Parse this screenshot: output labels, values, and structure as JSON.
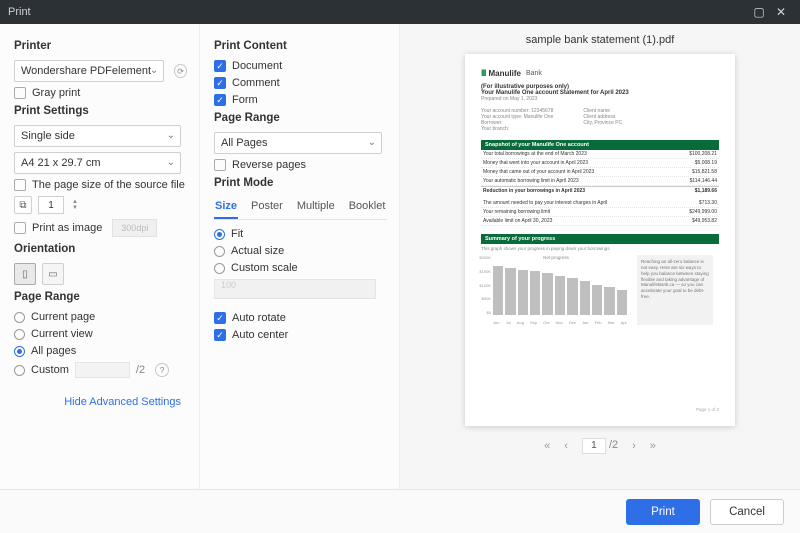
{
  "titlebar": {
    "title": "Print"
  },
  "printer": {
    "heading": "Printer",
    "selected": "Wondershare PDFelement",
    "gray_print": "Gray print"
  },
  "print_settings": {
    "heading": "Print Settings",
    "sides": "Single side",
    "paper": "A4 21 x 29.7 cm",
    "source_size": "The page size of the source file",
    "copies": "1",
    "print_as_image": "Print as image",
    "dpi_placeholder": "300dpi"
  },
  "orientation": {
    "heading": "Orientation"
  },
  "page_range_left": {
    "heading": "Page Range",
    "current_page": "Current page",
    "current_view": "Current view",
    "all_pages": "All pages",
    "custom": "Custom",
    "total_suffix": "/2"
  },
  "advanced_link": "Hide Advanced Settings",
  "print_content": {
    "heading": "Print Content",
    "document": "Document",
    "comment": "Comment",
    "form": "Form"
  },
  "page_range_right": {
    "heading": "Page Range",
    "selected": "All Pages",
    "reverse": "Reverse pages"
  },
  "print_mode": {
    "heading": "Print Mode",
    "tabs": [
      "Size",
      "Poster",
      "Multiple",
      "Booklet"
    ],
    "fit": "Fit",
    "actual": "Actual size",
    "custom_scale": "Custom scale",
    "scale_placeholder": "100",
    "auto_rotate": "Auto rotate",
    "auto_center": "Auto center"
  },
  "preview": {
    "filename": "sample bank statement (1).pdf",
    "logo_brand": "Manulife",
    "logo_sub": "Bank",
    "illustrative": "(For illustrative purposes only)",
    "stmt_line": "Your Manulife One account Statement for April 2023",
    "prepared": "Prepared on May 1, 2023",
    "col_a": [
      "Your account number: 12345678",
      "Your account type: Manulife One",
      "Borrower:",
      "Your branch:"
    ],
    "col_b": [
      "Client name",
      "Client address",
      "City, Province PC"
    ],
    "section1": "Snapshot of your Manulife One account",
    "rows1": [
      {
        "l": "Your total borrowings at the end of March 2023",
        "r": "$100,208.21"
      },
      {
        "l": "Money that went into your account in April 2023",
        "r": "$5,008.19"
      },
      {
        "l": "Money that came out of your account in April 2023",
        "r": "$15,821.58"
      },
      {
        "l": "Your automatic borrowing limit in April 2023",
        "r": "$114,146.44"
      }
    ],
    "reduction": {
      "l": "Reduction in your borrowings in April 2023",
      "r": "$1,189.66"
    },
    "rows2": [
      {
        "l": "The amount needed to pay your interest charges in April",
        "r": "$713.30"
      },
      {
        "l": "Your remaining borrowing limit",
        "r": "$249,999.00"
      },
      {
        "l": "Available limit on April 30, 2023",
        "r": "$49,953.82"
      }
    ],
    "section2": "Summary of your progress",
    "progress_sub": "This graph shows your progress in paying down your borrowings",
    "chart_note": "Reaching an all-zero balance is not easy. Here are six ways to help you balance between staying flexible and taking advantage of ManulifeBank.ca — so you can accelerate your goal to be debt-free.",
    "page_no": "Page 1 of 2"
  },
  "chart_data": {
    "type": "bar",
    "title": "Net progress",
    "xlabel": "",
    "ylabel": "",
    "x_ticks": [
      "Jun",
      "Jul",
      "Aug",
      "Sep",
      "Oct",
      "Nov",
      "Dec",
      "Jan",
      "Feb",
      "Mar",
      "Apr"
    ],
    "y_ticks": [
      "$0",
      "$50K",
      "$100K",
      "$150K",
      "$200K"
    ],
    "values": [
      195,
      190,
      182,
      176,
      168,
      158,
      148,
      135,
      122,
      112,
      100
    ],
    "ylim": [
      0,
      200
    ]
  },
  "pager": {
    "current": "1",
    "total": "/2"
  },
  "footer": {
    "print": "Print",
    "cancel": "Cancel"
  }
}
